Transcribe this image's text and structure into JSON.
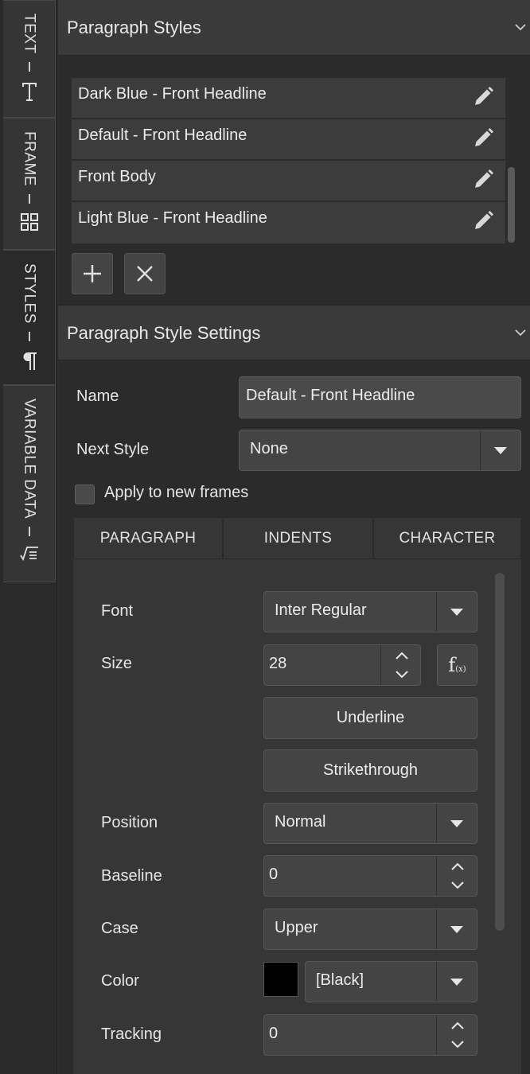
{
  "rail": {
    "tabs": [
      {
        "label": "TEXT",
        "icon": "text-t-icon"
      },
      {
        "label": "FRAME",
        "icon": "frame-grid-icon"
      },
      {
        "label": "STYLES",
        "icon": "pilcrow-icon"
      },
      {
        "label": "VARIABLE DATA",
        "icon": "variable-data-icon"
      }
    ],
    "active": "STYLES"
  },
  "paragraph_styles": {
    "title": "Paragraph Styles",
    "items": [
      {
        "label": "Dark Blue - Front Headline"
      },
      {
        "label": "Default - Front Headline"
      },
      {
        "label": "Front Body"
      },
      {
        "label": "Light Blue - Front Headline"
      }
    ]
  },
  "settings": {
    "title": "Paragraph Style Settings",
    "name_label": "Name",
    "name_value": "Default - Front Headline",
    "next_style_label": "Next Style",
    "next_style_value": "None",
    "apply_label": "Apply to new frames",
    "apply_checked": false,
    "tabs": [
      "PARAGRAPH",
      "INDENTS",
      "CHARACTER"
    ],
    "character": {
      "font_label": "Font",
      "font_value": "Inter Regular",
      "size_label": "Size",
      "size_value": "28",
      "fx_label": "f",
      "fx_sub": "(x)",
      "underline_label": "Underline",
      "strikethrough_label": "Strikethrough",
      "position_label": "Position",
      "position_value": "Normal",
      "baseline_label": "Baseline",
      "baseline_value": "0",
      "case_label": "Case",
      "case_value": "Upper",
      "color_label": "Color",
      "color_value": "[Black]",
      "color_swatch": "#000000",
      "tracking_label": "Tracking",
      "tracking_value": "0"
    }
  }
}
